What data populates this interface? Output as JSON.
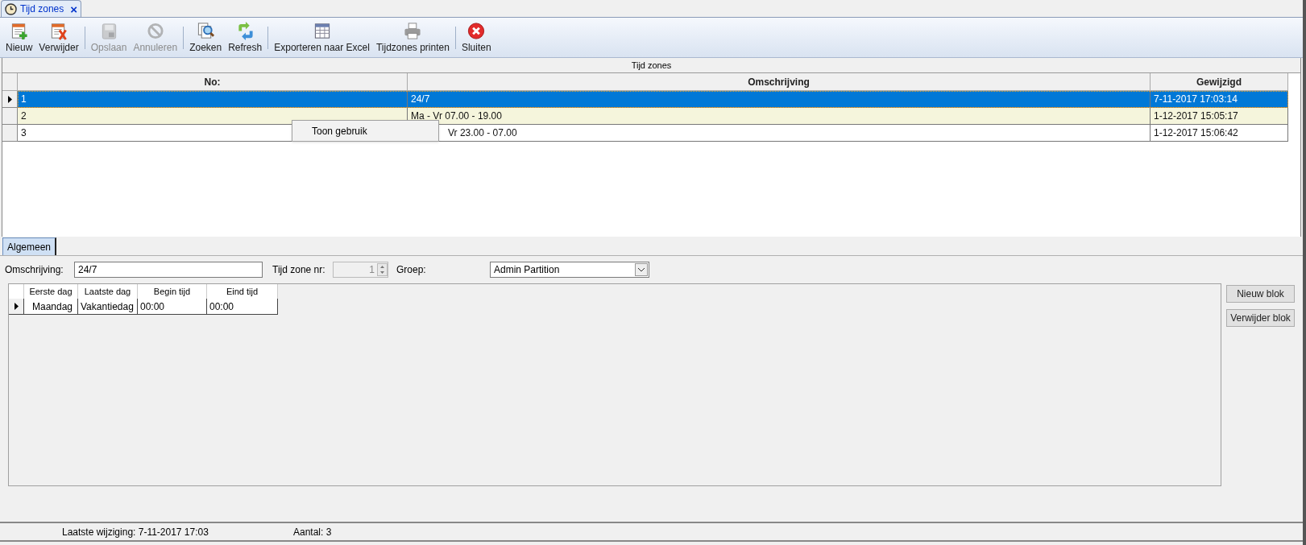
{
  "document_tab": {
    "title": "Tijd zones",
    "close": "×"
  },
  "toolbar": [
    {
      "label": "Nieuw",
      "kind": "new",
      "disabled": false
    },
    {
      "label": "Verwijder",
      "kind": "delete",
      "disabled": false
    },
    {
      "label": "Opslaan",
      "kind": "save",
      "disabled": true
    },
    {
      "label": "Annuleren",
      "kind": "cancel",
      "disabled": true
    },
    {
      "label": "Zoeken",
      "kind": "search",
      "disabled": false
    },
    {
      "label": "Refresh",
      "kind": "refresh",
      "disabled": false
    },
    {
      "label": "Exporteren naar Excel",
      "kind": "excel",
      "disabled": false
    },
    {
      "label": "Tijdzones printen",
      "kind": "print",
      "disabled": false
    },
    {
      "label": "Sluiten",
      "kind": "close",
      "disabled": false
    }
  ],
  "grid": {
    "caption": "Tijd zones",
    "columns": [
      "No:",
      "Omschrijving",
      "Gewijzigd"
    ],
    "rows": [
      {
        "cells": [
          "1",
          "24/7",
          "7-11-2017 17:03:14"
        ],
        "selected": true
      },
      {
        "cells": [
          "2",
          "Ma - Vr 07.00 - 19.00",
          "1-12-2017 15:05:17"
        ],
        "selected": false
      },
      {
        "cells": [
          "3",
          "Vr 23.00 - 07.00",
          "1-12-2017 15:06:42"
        ],
        "selected": false
      }
    ]
  },
  "context_menu": {
    "items": [
      "Toon gebruik"
    ]
  },
  "detail_tabs": [
    {
      "label": "Algemeen",
      "selected": true
    }
  ],
  "form": {
    "omschrijving_label": "Omschrijving:",
    "omschrijving": "24/7",
    "nr_label": "Tijd zone nr:",
    "nr": "1",
    "groep_label": "Groep:",
    "groep": "Admin Partition"
  },
  "blocks": {
    "columns": [
      "Eerste dag",
      "Laatste dag",
      "Begin tijd",
      "Eind tijd"
    ],
    "rows": [
      {
        "cells": [
          "Maandag",
          "Vakantiedag",
          "00:00",
          "00:00"
        ]
      }
    ]
  },
  "block_buttons": [
    "Nieuw blok",
    "Verwijder blok"
  ],
  "status_bar": [
    "Laatste wijziging: 7-11-2017 17:03",
    "Aantal: 3"
  ]
}
